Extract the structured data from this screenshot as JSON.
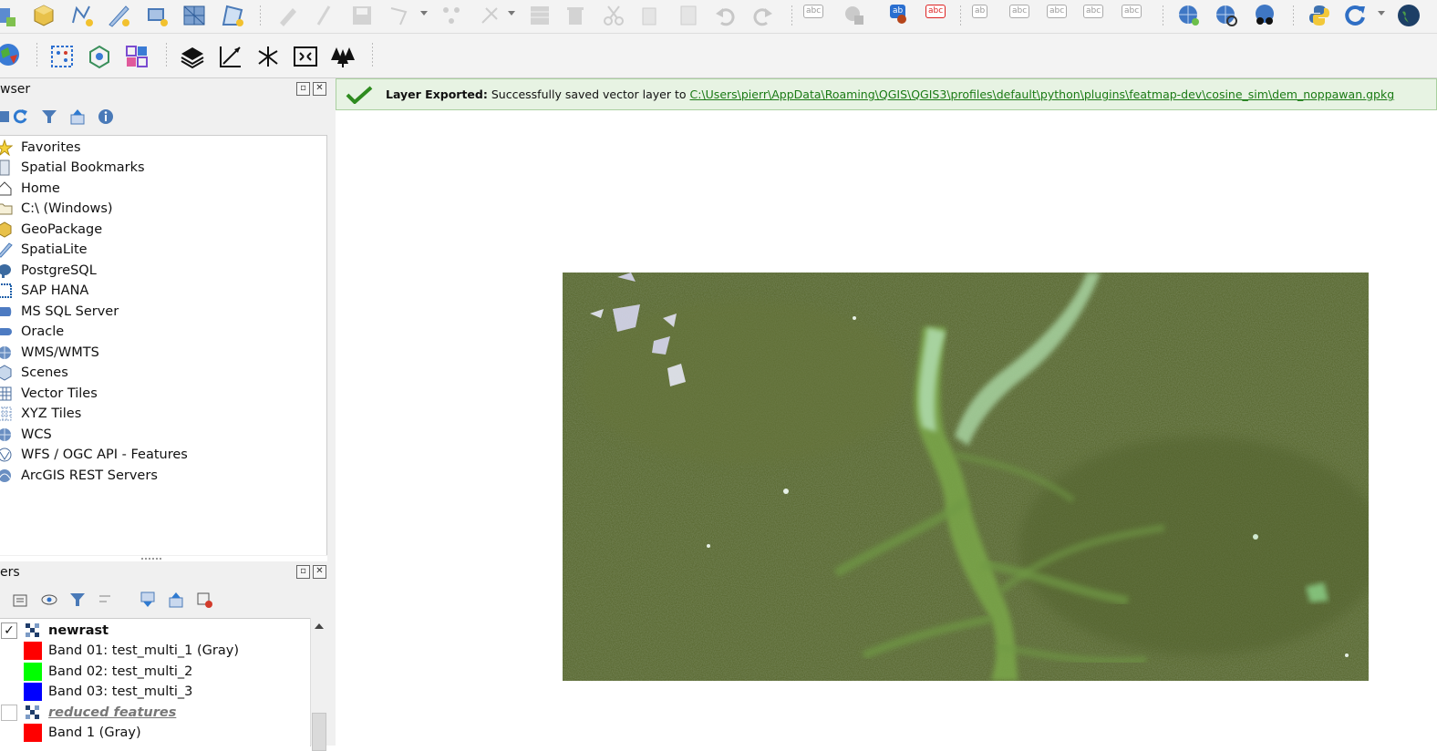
{
  "colors": {
    "toolbar_bg": "#f3f3f3",
    "panel_bg": "#f0f0f0",
    "message_bg": "#e7f3e3",
    "message_link": "#1a7a14",
    "band_red": "#ff0000",
    "band_green": "#00ff00",
    "band_blue": "#0000ff"
  },
  "toolbar1": {
    "icons": [
      "new-geopackage-layer-icon",
      "new-spatialite-layer-icon",
      "new-vector-layer-icon",
      "new-scratch-layer-icon",
      "new-virtual-layer-icon",
      "new-mesh-layer-icon",
      "digitize-polygon-icon",
      "edit-pencil-icon",
      "toggle-edit-icon",
      "save-edits-icon",
      "vertex-tool-icon",
      "add-point-icon",
      "node-tool-icon",
      "attributes-icon",
      "delete-icon",
      "cut-icon",
      "copy-icon",
      "paste-icon",
      "undo-icon",
      "redo-icon",
      "label-icon",
      "label-rules-icon",
      "label-pin-icon",
      "label-highlight-icon",
      "label-show-hide-icon",
      "label-move-icon",
      "label-rotate-icon",
      "label-change-icon",
      "metasearch-icon",
      "wcs-icon",
      "identify-web-icon",
      "python-console-icon",
      "sync-icon",
      "globe-icon"
    ],
    "label_tool_text": "abc",
    "label_tool_text_2": "ab"
  },
  "toolbar2": {
    "icons": [
      "globe-color-icon",
      "select-features-icon",
      "network-icon",
      "grid-layout-icon",
      "layer-stack-icon",
      "measure-icon",
      "star-burst-icon",
      "extent-icon",
      "trees-icon"
    ]
  },
  "browser": {
    "title": "wser",
    "items": [
      {
        "label": "Favorites",
        "icon": "star-icon"
      },
      {
        "label": "Spatial Bookmarks",
        "icon": "bookmark-icon"
      },
      {
        "label": "Home",
        "icon": "home-icon"
      },
      {
        "label": "C:\\ (Windows)",
        "icon": "folder-icon"
      },
      {
        "label": "GeoPackage",
        "icon": "geopackage-icon"
      },
      {
        "label": "SpatiaLite",
        "icon": "spatialite-icon"
      },
      {
        "label": "PostgreSQL",
        "icon": "postgresql-icon"
      },
      {
        "label": "SAP HANA",
        "icon": "hana-icon"
      },
      {
        "label": "MS SQL Server",
        "icon": "mssql-icon"
      },
      {
        "label": "Oracle",
        "icon": "oracle-icon"
      },
      {
        "label": "WMS/WMTS",
        "icon": "wms-icon"
      },
      {
        "label": "Scenes",
        "icon": "scenes-icon"
      },
      {
        "label": "Vector Tiles",
        "icon": "vector-tiles-icon"
      },
      {
        "label": "XYZ Tiles",
        "icon": "xyz-tiles-icon"
      },
      {
        "label": "WCS",
        "icon": "wcs-icon"
      },
      {
        "label": "WFS / OGC API - Features",
        "icon": "wfs-icon"
      },
      {
        "label": "ArcGIS REST Servers",
        "icon": "arcgis-icon"
      }
    ]
  },
  "layers": {
    "title": "ers",
    "rows": [
      {
        "label": "newrast",
        "type": "raster",
        "checked": true,
        "check_glyph": "✓",
        "bold": true
      },
      {
        "label": "Band 01: test_multi_1 (Gray)",
        "type": "band",
        "color": "#ff0000"
      },
      {
        "label": "Band 02: test_multi_2",
        "type": "band",
        "color": "#00ff00"
      },
      {
        "label": "Band 03: test_multi_3",
        "type": "band",
        "color": "#0000ff"
      },
      {
        "label": "reduced features",
        "type": "raster",
        "checked": false,
        "italic": true
      },
      {
        "label": "Band 1 (Gray)",
        "type": "band",
        "color": "#ff0000"
      }
    ]
  },
  "message": {
    "title": "Layer Exported:",
    "text": "Successfully saved vector layer to",
    "link": "C:\\Users\\pierr\\AppData\\Roaming\\QGIS\\QGIS3\\profiles\\default\\python\\plugins\\featmap-dev\\cosine_sim\\dem_noppawan.gpkg"
  },
  "map": {
    "layer": "newrast",
    "description_icon": "satellite-raster-image"
  }
}
